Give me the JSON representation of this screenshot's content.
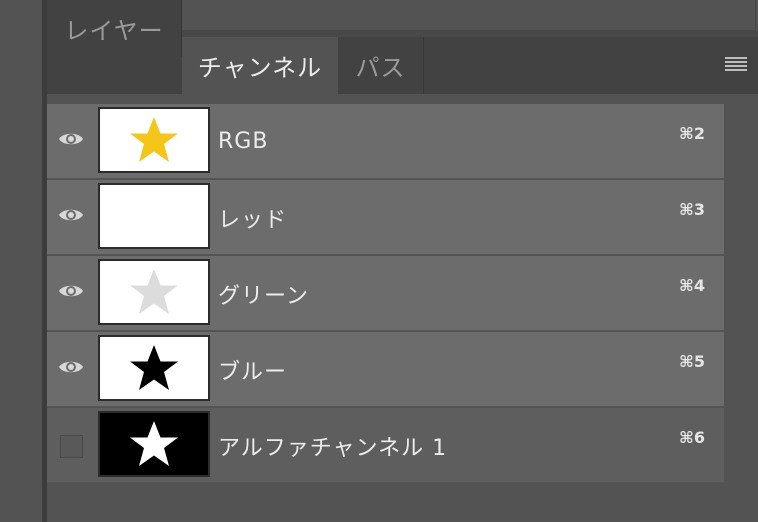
{
  "tabs": [
    {
      "label": "レイヤー",
      "active": false
    },
    {
      "label": "チャンネル",
      "active": true
    },
    {
      "label": "パス",
      "active": false
    }
  ],
  "channels": [
    {
      "name": "RGB",
      "shortcut": "⌘2",
      "visible": true,
      "thumb_bg": "#ffffff",
      "star_color": "#f5c518"
    },
    {
      "name": "レッド",
      "shortcut": "⌘3",
      "visible": true,
      "thumb_bg": "#ffffff",
      "star_color": "#ffffff"
    },
    {
      "name": "グリーン",
      "shortcut": "⌘4",
      "visible": true,
      "thumb_bg": "#ffffff",
      "star_color": "#dcdcdc"
    },
    {
      "name": "ブルー",
      "shortcut": "⌘5",
      "visible": true,
      "thumb_bg": "#ffffff",
      "star_color": "#000000"
    },
    {
      "name": "アルファチャンネル 1",
      "shortcut": "⌘6",
      "visible": false,
      "thumb_bg": "#000000",
      "star_color": "#ffffff"
    }
  ],
  "icons": {
    "visibility": "eye-icon",
    "panel_menu": "hamburger-menu-icon",
    "thumbnail": "star-icon"
  }
}
